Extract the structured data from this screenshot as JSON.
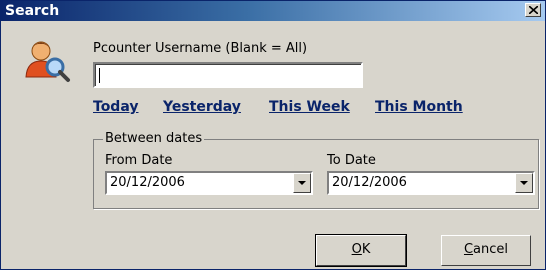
{
  "window": {
    "title": "Search",
    "close_glyph": "✕"
  },
  "form": {
    "username_label": "Pcounter Username (Blank = All)",
    "username_value": ""
  },
  "quick_links": [
    {
      "label": "Today"
    },
    {
      "label": "Yesterday"
    },
    {
      "label": "This Week"
    },
    {
      "label": "This Month"
    }
  ],
  "dates": {
    "group_label": "Between dates",
    "from_label": "From Date",
    "from_value": "20/12/2006",
    "to_label": "To Date",
    "to_value": "20/12/2006"
  },
  "buttons": {
    "ok": {
      "accel": "O",
      "rest": "K"
    },
    "cancel": {
      "accel": "C",
      "rest": "ancel"
    }
  },
  "icons": {
    "user_search": "user-magnifier-icon",
    "dropdown": "chevron-down-icon",
    "close": "close-icon"
  }
}
